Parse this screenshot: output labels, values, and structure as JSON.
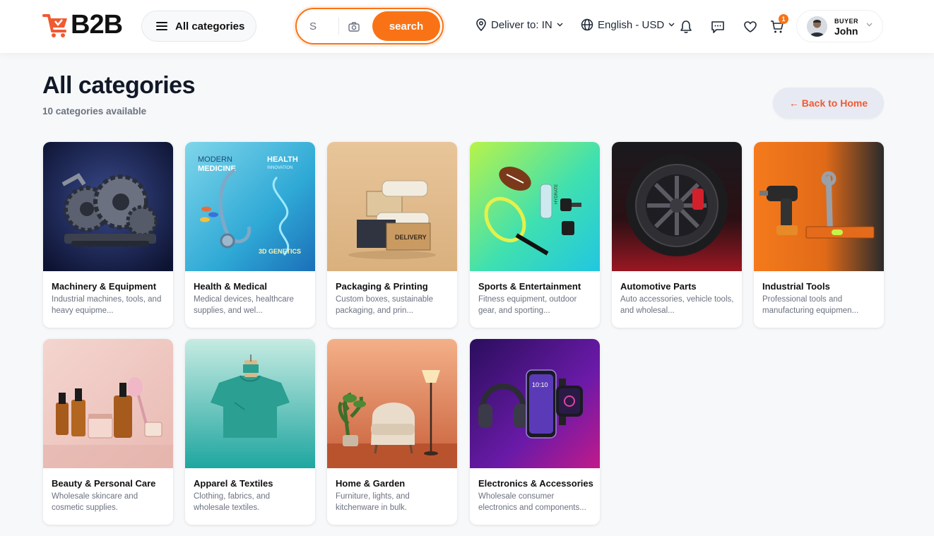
{
  "header": {
    "logo_text": "B2B",
    "categories_button": "All categories",
    "search": {
      "value": "S",
      "button": "search"
    },
    "deliver": "Deliver to: IN",
    "language": "English - USD",
    "cart_count": "1",
    "user": {
      "role": "BUYER",
      "name": "John"
    }
  },
  "page": {
    "title": "All categories",
    "subtitle": "10 categories available",
    "back_button": "← Back to Home"
  },
  "categories": [
    {
      "title": "Machinery & Equipment",
      "desc": "Industrial machines, tools, and heavy equipme..."
    },
    {
      "title": "Health & Medical",
      "desc": "Medical devices, healthcare supplies, and wel..."
    },
    {
      "title": "Packaging & Printing",
      "desc": "Custom boxes, sustainable packaging, and prin..."
    },
    {
      "title": "Sports & Entertainment",
      "desc": "Fitness equipment, outdoor gear, and sporting..."
    },
    {
      "title": "Automotive Parts",
      "desc": "Auto accessories, vehicle tools, and wholesal..."
    },
    {
      "title": "Industrial Tools",
      "desc": "Professional tools and manufacturing equipmen..."
    },
    {
      "title": "Beauty & Personal Care",
      "desc": "Wholesale skincare and cosmetic supplies."
    },
    {
      "title": "Apparel & Textiles",
      "desc": "Clothing, fabrics, and wholesale textiles."
    },
    {
      "title": "Home & Garden",
      "desc": "Furniture, lights, and kitchenware in bulk."
    },
    {
      "title": "Electronics & Accessories",
      "desc": "Wholesale consumer electronics and components..."
    }
  ],
  "image_text": {
    "health": [
      "MODERN",
      "MEDICINE",
      "HEALTH",
      "INNOVATION",
      "3D GENETICS"
    ],
    "packaging_box": "DELIVERY",
    "bottle": "HYDRATE",
    "watch": "10:10"
  },
  "colors": {
    "accent": "#f97316",
    "back_text": "#f05a32"
  },
  "icons": [
    "menu-icon",
    "camera-icon",
    "location-pin-icon",
    "chevron-down-icon",
    "globe-icon",
    "bell-icon",
    "chat-icon",
    "heart-icon",
    "cart-icon"
  ]
}
